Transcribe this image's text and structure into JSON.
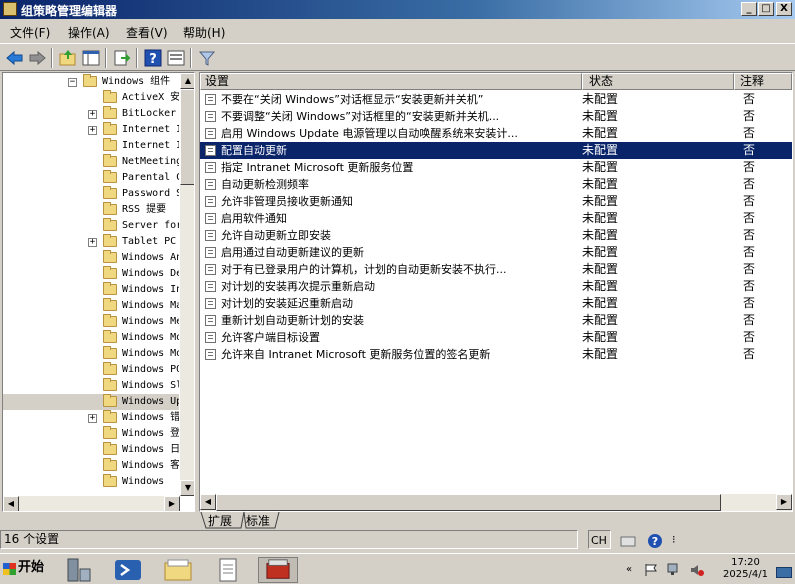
{
  "window": {
    "title": "组策略管理编辑器"
  },
  "title_buttons": {
    "minimize": "_",
    "maximize": "□",
    "close": "X"
  },
  "menu": [
    "文件(F)",
    "操作(A)",
    "查看(V)",
    "帮助(H)"
  ],
  "toolbar_icons": [
    "back-arrow-icon",
    "forward-arrow-icon",
    "up-folder-icon",
    "show-hide-tree-icon",
    "export-list-icon",
    "help-icon",
    "properties-icon",
    "filter-icon"
  ],
  "tree": {
    "items": [
      {
        "label": "Windows 组件"
      },
      {
        "label": "ActiveX 安装程序服务"
      },
      {
        "label": "ActiveX 安"
      },
      {
        "label": "BitLocker"
      },
      {
        "label": "Internet I"
      },
      {
        "label": "Internet I"
      },
      {
        "label": "NetMeeting"
      },
      {
        "label": "Parental C"
      },
      {
        "label": "Password S"
      },
      {
        "label": "RSS 提要"
      },
      {
        "label": "Server for"
      },
      {
        "label": "Tablet PC"
      },
      {
        "label": "Windows An"
      },
      {
        "label": "Windows De"
      },
      {
        "label": "Windows In"
      },
      {
        "label": "Windows Ma"
      },
      {
        "label": "Windows Me"
      },
      {
        "label": "Windows Mo"
      },
      {
        "label": "Windows Mo"
      },
      {
        "label": "Windows PO"
      },
      {
        "label": "Windows Sl"
      },
      {
        "label": "Windows Up"
      },
      {
        "label": "Windows 错"
      },
      {
        "label": "Windows 登"
      },
      {
        "label": "Windows 日"
      },
      {
        "label": "Windows 客"
      },
      {
        "label": "Windows"
      }
    ]
  },
  "list": {
    "columns": {
      "name": "设置",
      "status": "状态",
      "note": "注释"
    },
    "rows": [
      {
        "name": "不要在“关闭 Windows”对话框显示“安装更新并关机”",
        "status": "未配置",
        "note": "否"
      },
      {
        "name": "不要调整“关闭 Windows”对话框里的“安装更新并关机...",
        "status": "未配置",
        "note": "否"
      },
      {
        "name": "启用 Windows Update 电源管理以自动唤醒系统来安装计...",
        "status": "未配置",
        "note": "否"
      },
      {
        "name": "配置自动更新",
        "status": "未配置",
        "note": "否"
      },
      {
        "name": "指定 Intranet Microsoft 更新服务位置",
        "status": "未配置",
        "note": "否"
      },
      {
        "name": "自动更新检测频率",
        "status": "未配置",
        "note": "否"
      },
      {
        "name": "允许非管理员接收更新通知",
        "status": "未配置",
        "note": "否"
      },
      {
        "name": "启用软件通知",
        "status": "未配置",
        "note": "否"
      },
      {
        "name": "允许自动更新立即安装",
        "status": "未配置",
        "note": "否"
      },
      {
        "name": "启用通过自动更新建议的更新",
        "status": "未配置",
        "note": "否"
      },
      {
        "name": "对于有已登录用户的计算机，计划的自动更新安装不执行...",
        "status": "未配置",
        "note": "否"
      },
      {
        "name": "对计划的安装再次提示重新启动",
        "status": "未配置",
        "note": "否"
      },
      {
        "name": "对计划的安装延迟重新启动",
        "status": "未配置",
        "note": "否"
      },
      {
        "name": "重新计划自动更新计划的安装",
        "status": "未配置",
        "note": "否"
      },
      {
        "name": "允许客户端目标设置",
        "status": "未配置",
        "note": "否"
      },
      {
        "name": "允许来自 Intranet Microsoft 更新服务位置的签名更新",
        "status": "未配置",
        "note": "否"
      }
    ],
    "selected_index": 3
  },
  "tabs": [
    "扩展",
    "标准"
  ],
  "status": {
    "count_text": "16 个设置"
  },
  "taskbar": {
    "start_label": "开始",
    "ime": "CH",
    "time": "17:20",
    "date": "2025/4/1"
  }
}
